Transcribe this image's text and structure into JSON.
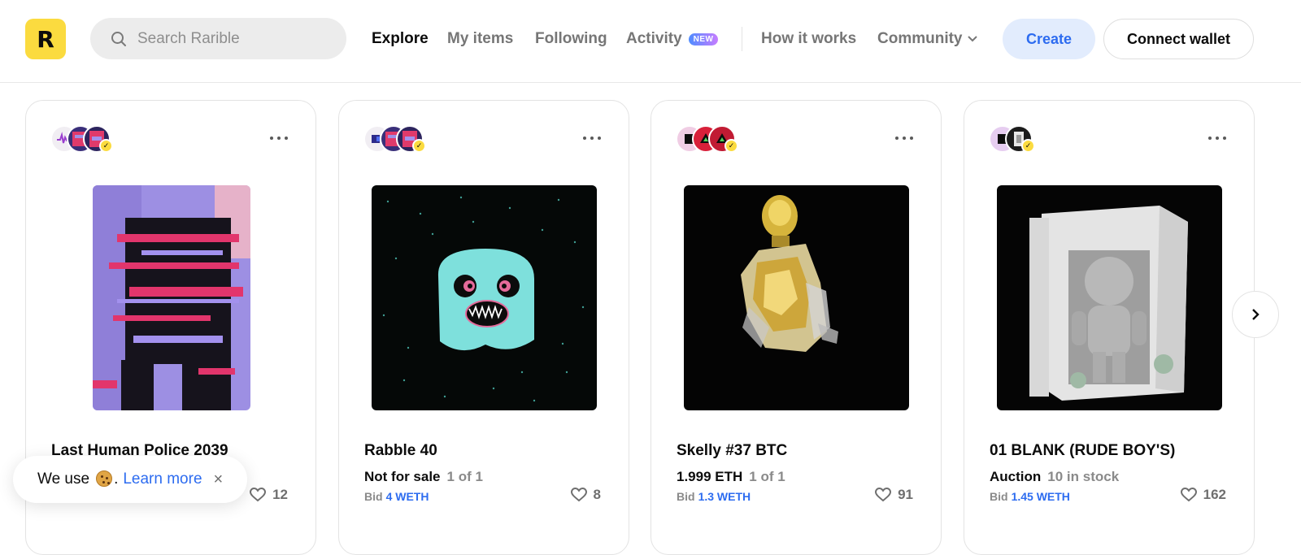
{
  "header": {
    "logo_letter": "R",
    "search": {
      "placeholder": "Search Rarible"
    },
    "nav": [
      {
        "label": "Explore",
        "active": true
      },
      {
        "label": "My items",
        "active": false
      },
      {
        "label": "Following",
        "active": false
      },
      {
        "label": "Activity",
        "badge": "NEW",
        "active": false
      },
      {
        "label": "How it works",
        "active": false
      },
      {
        "label": "Community",
        "active": false
      }
    ],
    "create_label": "Create",
    "wallet_label": "Connect wallet"
  },
  "cards": [
    {
      "title": "Last Human Police 2039",
      "price": "",
      "stock": "",
      "bid_prefix": "",
      "bid_value": "",
      "likes": "12"
    },
    {
      "title": "Rabble 40",
      "price": "Not for sale",
      "stock": "1 of 1",
      "bid_prefix": "Bid",
      "bid_value": "4 WETH",
      "likes": "8"
    },
    {
      "title": "Skelly #37 BTC",
      "price": "1.999 ETH",
      "stock": "1 of 1",
      "bid_prefix": "Bid",
      "bid_value": "1.3 WETH",
      "likes": "91"
    },
    {
      "title": "01 BLANK (RUDE BOY'S)",
      "price": "Auction",
      "stock": "10 in stock",
      "bid_prefix": "Bid",
      "bid_value": "1.45 WETH",
      "likes": "162"
    }
  ],
  "cookie": {
    "text_before": "We use",
    "text_after": ".",
    "learn_more": "Learn more",
    "close": "×"
  },
  "colors": {
    "brand_yellow": "#fbdb3f",
    "accent_blue": "#2d6cf0",
    "create_bg": "#e2ecfd"
  },
  "icons": [
    "search-icon",
    "chevron-down-icon",
    "more-icon",
    "heart-icon",
    "verified-icon",
    "chevron-right-icon",
    "cookie-icon",
    "close-icon"
  ]
}
